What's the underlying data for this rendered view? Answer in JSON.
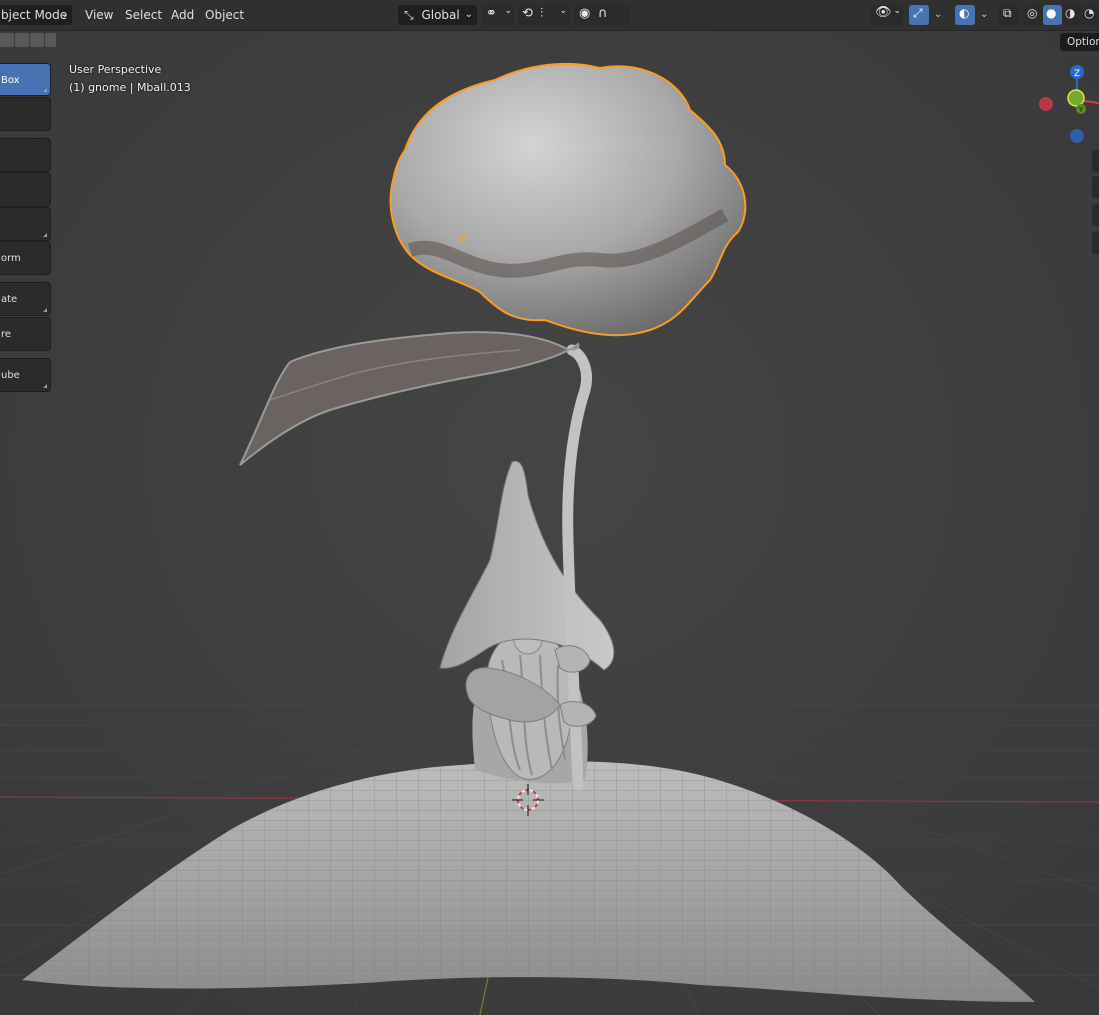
{
  "header": {
    "mode_label": "bject Mode",
    "menus": [
      "View",
      "Select",
      "Add",
      "Object"
    ],
    "orientation_label": "Global"
  },
  "toolbar": {
    "tools": [
      "Box",
      "",
      "",
      "",
      "",
      "orm",
      "ate",
      "re",
      "ube"
    ],
    "active_index": 0
  },
  "overlay": {
    "view_name": "User Perspective",
    "object_info": "(1) gnome | Mball.013"
  },
  "sidebar": {
    "options_label": "Option"
  },
  "gizmo": {
    "axis_z": "Z",
    "axis_y": "Y",
    "colors": {
      "x": "#d9394d",
      "y": "#75a82b",
      "z": "#2b68c8"
    }
  },
  "colors": {
    "selection_outline": "#ff9a22",
    "active_tool": "#4772b3",
    "background": "#3a3a3a"
  },
  "icons": [
    "select-box-icon",
    "select-extend-icon",
    "select-subtract-icon",
    "select-invert-icon",
    "transform-orientation-icon",
    "pivot-icon",
    "snap-icon",
    "proportional-edit-icon",
    "visibility-icon",
    "gizmo-icon",
    "overlay-icon",
    "xray-icon",
    "wireframe-shading-icon",
    "solid-shading-icon",
    "material-shading-icon",
    "rendered-shading-icon",
    "axis-gizmo-icon"
  ]
}
